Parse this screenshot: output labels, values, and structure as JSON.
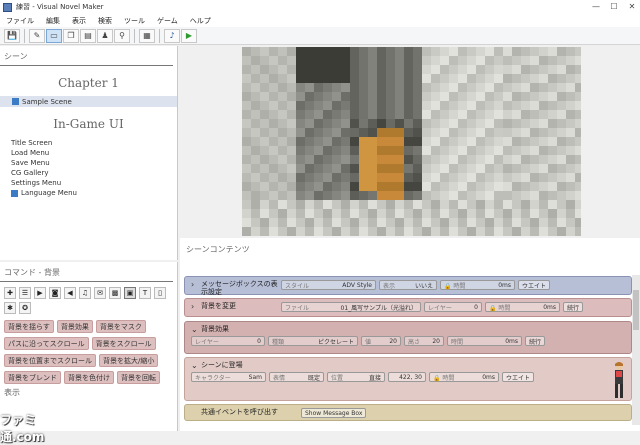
{
  "window": {
    "title": "練習 - Visual Novel Maker"
  },
  "menu": [
    "ファイル",
    "編集",
    "表示",
    "検索",
    "ツール",
    "ゲーム",
    "ヘルプ"
  ],
  "toolbar": [
    {
      "icon": "save-icon",
      "glyph": "💾"
    },
    {
      "icon": "pencil-icon",
      "glyph": "✎"
    },
    {
      "icon": "scene-editor-icon",
      "glyph": "▭"
    },
    {
      "icon": "copy-icon",
      "glyph": "❐"
    },
    {
      "icon": "document-icon",
      "glyph": "▤"
    },
    {
      "icon": "character-icon",
      "glyph": "♟"
    },
    {
      "icon": "link-icon",
      "glyph": "⚲"
    },
    {
      "icon": "database-icon",
      "glyph": "▦"
    },
    {
      "icon": "music-icon",
      "glyph": "♪"
    },
    {
      "icon": "play-icon",
      "glyph": "▶"
    }
  ],
  "scenes_panel": {
    "title": "シーン",
    "chapter": "Chapter 1",
    "scene": "Sample Scene",
    "ingame_title": "In-Game UI",
    "ingame_items": [
      "Title Screen",
      "Load Menu",
      "Save Menu",
      "CG Gallery",
      "Settings Menu",
      "Language Menu"
    ]
  },
  "commands_panel": {
    "title": "コマンド - 背景",
    "category_icons": [
      {
        "icon": "add-icon",
        "glyph": "✚"
      },
      {
        "icon": "text-icon",
        "glyph": "☰"
      },
      {
        "icon": "video-icon",
        "glyph": "▶"
      },
      {
        "icon": "camera-icon",
        "glyph": "◙"
      },
      {
        "icon": "audio-icon",
        "glyph": "◀"
      },
      {
        "icon": "sound-icon",
        "glyph": "♫"
      },
      {
        "icon": "message-icon",
        "glyph": "✉"
      },
      {
        "icon": "background-icon",
        "glyph": "▩"
      },
      {
        "icon": "picture-icon",
        "glyph": "▣"
      },
      {
        "icon": "layer-icon",
        "glyph": "T"
      },
      {
        "icon": "variable-icon",
        "glyph": "▯"
      },
      {
        "icon": "settings-icon",
        "glyph": "✱"
      },
      {
        "icon": "effect-icon",
        "glyph": "✪"
      }
    ],
    "buttons": [
      "背景を揺らす",
      "背景効果",
      "背景をマスク",
      "パスに沿ってスクロール",
      "背景をスクロール",
      "背景を位置までスクロール",
      "背景を拡大/縮小",
      "背景をブレンド",
      "背景を色付け",
      "背景を回転"
    ],
    "sub_title": "表示"
  },
  "scene_content": {
    "title": "シーンコンテンツ",
    "rows": [
      {
        "name": "メッセージボックスの表示設定",
        "color": "#b7bfd6",
        "border": "#8a93b5",
        "fields": [
          {
            "k": "スタイル",
            "v": "ADV Style",
            "w": 95
          },
          {
            "k": "表示",
            "v": "いいえ",
            "w": 58
          },
          {
            "k": "🔒 時間",
            "v": "0ms",
            "w": 75
          }
        ],
        "pills": [
          "ウエイト"
        ]
      },
      {
        "name": "背景を変更",
        "color": "#dcbcbc",
        "border": "#b98f8f",
        "fields": [
          {
            "k": "ファイル",
            "v": "01_風写サンプル（光溢れ）",
            "w": 140
          },
          {
            "k": "レイヤー",
            "v": "0",
            "w": 58
          },
          {
            "k": "🔒 時間",
            "v": "0ms",
            "w": 75
          }
        ],
        "pills": [
          "続行"
        ]
      },
      {
        "name": "背景効果",
        "color": "#d4b1b1",
        "border": "#b08787",
        "fields": [
          {
            "k": "レイヤー",
            "v": "0",
            "w": 74
          },
          {
            "k": "種類",
            "v": "ピクセレート",
            "w": 90
          },
          {
            "k": "値",
            "v": "20",
            "w": 40
          },
          {
            "k": "高さ",
            "v": "20",
            "w": 40
          },
          {
            "k": "時間",
            "v": "0ms",
            "w": 75
          }
        ],
        "pills": [
          "続行"
        ]
      },
      {
        "name": "シーンに登場",
        "color": "#e2cbc6",
        "border": "#c4a39c",
        "fields": [
          {
            "k": "キャラクター",
            "v": "Sam",
            "w": 75
          },
          {
            "k": "表情",
            "v": "既定",
            "w": 55
          },
          {
            "k": "位置",
            "v": "直接",
            "w": 58
          },
          {
            "k": "",
            "v": "422, 30",
            "w": 38
          },
          {
            "k": "🔒 時間",
            "v": "0ms",
            "w": 70
          }
        ],
        "pills": [
          "ウエイト"
        ]
      },
      {
        "name": "共通イベントを呼び出す",
        "color": "#dcd0ad",
        "border": "#bbaf88",
        "fields": [],
        "pills": [
          "Show Message Box"
        ]
      }
    ]
  },
  "watermark": "ファミ通.com"
}
